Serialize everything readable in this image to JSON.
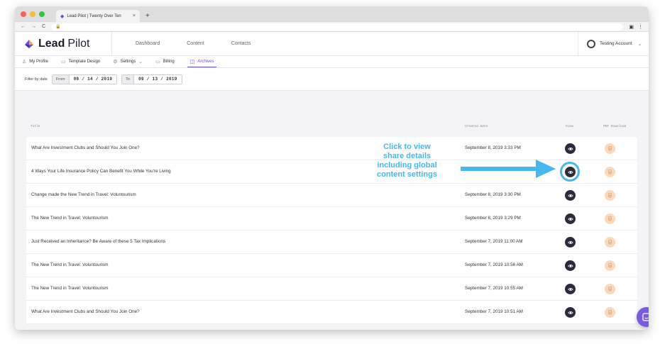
{
  "browser": {
    "tab_title": "Lead Pilot | Twenty Over Ten",
    "tab_close": "×",
    "new_tab": "+",
    "address": "🔒"
  },
  "app": {
    "brand_bold": "Lead",
    "brand_thin": "Pilot",
    "brand_color": "#6b4bd8",
    "main_nav": [
      "Dashboard",
      "Content",
      "Contacts"
    ],
    "account_name": "Testing Account"
  },
  "subnav": [
    {
      "label": "My Profile",
      "icon": "person-icon"
    },
    {
      "label": "Template Design",
      "icon": "template-icon"
    },
    {
      "label": "Settings",
      "icon": "gear-icon"
    },
    {
      "label": "Billing",
      "icon": "card-icon"
    },
    {
      "label": "Archives",
      "icon": "archive-icon"
    }
  ],
  "filter": {
    "label": "Filter by date",
    "from_label": "From",
    "from_value": "08 / 14 / 2019",
    "to_label": "To",
    "to_value": "09 / 13 / 2019"
  },
  "table": {
    "headers": {
      "title": "Title",
      "created": "Created Date",
      "view": "View",
      "pdf": "PDF Download"
    },
    "rows": [
      {
        "title": "What Are Investment Clubs and Should You Join One?",
        "date": "September 8, 2019 3:33 PM"
      },
      {
        "title": "4 Ways Your Life Insurance Policy Can Benefit You While You're Living",
        "date": ""
      },
      {
        "title": "Change made the New Trend in Travel: Voluntourism",
        "date": "September 8, 2019 3:30 PM"
      },
      {
        "title": "The New Trend in Travel: Voluntourism",
        "date": "September 8, 2019 3:29 PM"
      },
      {
        "title": "Just Received an Inheritance? Be Aware of these 5 Tax Implications",
        "date": "September 7, 2019 11:00 AM"
      },
      {
        "title": "The New Trend in Travel: Voluntourism",
        "date": "September 7, 2019 10:56 AM"
      },
      {
        "title": "The New Trend in Travel: Voluntourism",
        "date": "September 7, 2019 10:55 AM"
      },
      {
        "title": "What Are Investment Clubs and Should You Join One?",
        "date": "September 7, 2019 10:51 AM"
      }
    ]
  },
  "annotation": {
    "lines": [
      "Click to view",
      "share details",
      "including global",
      "content settings"
    ],
    "color": "#45b8ef"
  }
}
